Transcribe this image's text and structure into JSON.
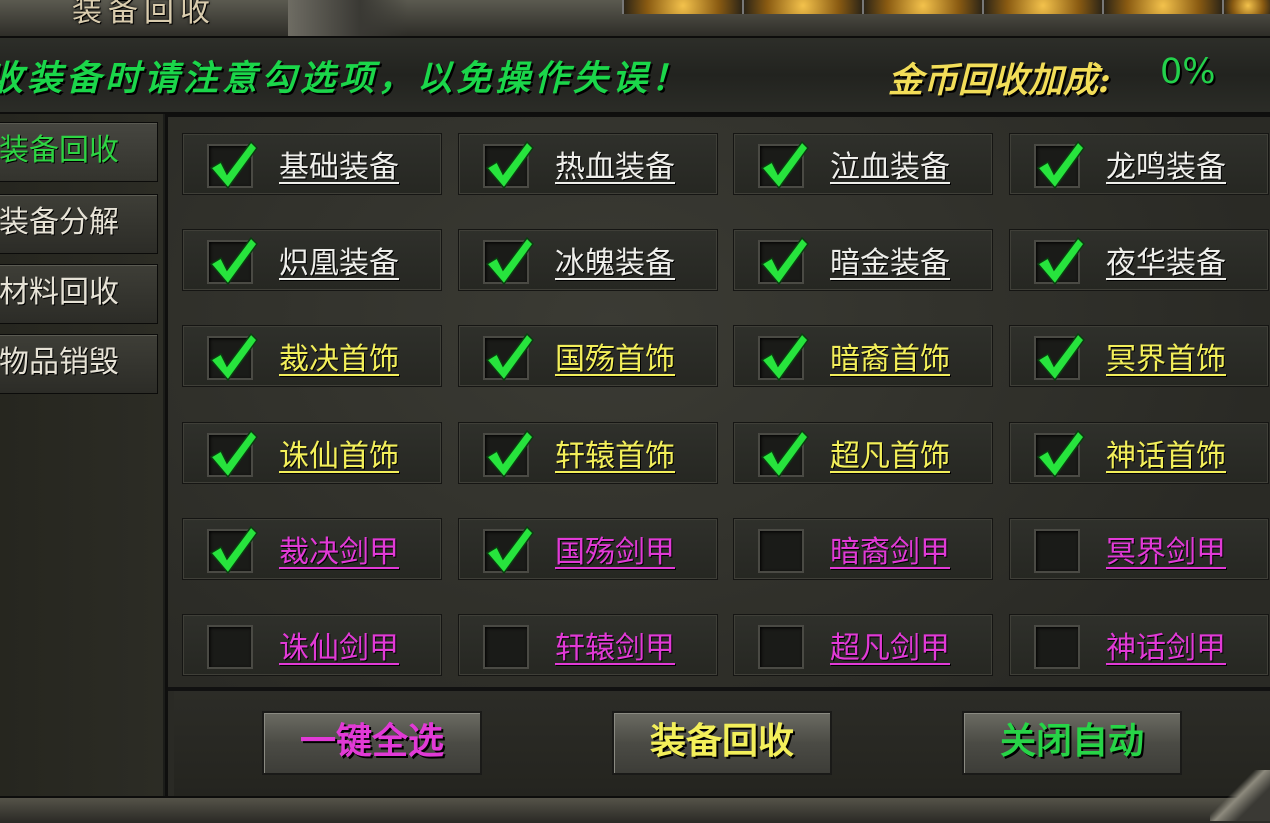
{
  "window": {
    "title": "装备回收"
  },
  "notice": {
    "text": "收装备时请注意勾选项，以免操作失误！",
    "bonus_label": "金币回收加成:",
    "bonus_value": "0%"
  },
  "sidebar": {
    "tabs": [
      {
        "label": "装备回收",
        "active": true
      },
      {
        "label": "装备分解",
        "active": false
      },
      {
        "label": "材料回收",
        "active": false
      },
      {
        "label": "物品销毁",
        "active": false
      }
    ]
  },
  "colors": {
    "white": "#eeeeea",
    "yellow": "#f3ef5a",
    "magenta": "#e13ad6",
    "green": "#27d447",
    "check": "#27e43d"
  },
  "items": [
    {
      "label": "基础装备",
      "checked": true,
      "color": "white"
    },
    {
      "label": "热血装备",
      "checked": true,
      "color": "white"
    },
    {
      "label": "泣血装备",
      "checked": true,
      "color": "white"
    },
    {
      "label": "龙鸣装备",
      "checked": true,
      "color": "white"
    },
    {
      "label": "炽凰装备",
      "checked": true,
      "color": "white"
    },
    {
      "label": "冰魄装备",
      "checked": true,
      "color": "white"
    },
    {
      "label": "暗金装备",
      "checked": true,
      "color": "white"
    },
    {
      "label": "夜华装备",
      "checked": true,
      "color": "white"
    },
    {
      "label": "裁决首饰",
      "checked": true,
      "color": "yellow"
    },
    {
      "label": "国殇首饰",
      "checked": true,
      "color": "yellow"
    },
    {
      "label": "暗裔首饰",
      "checked": true,
      "color": "yellow"
    },
    {
      "label": "冥界首饰",
      "checked": true,
      "color": "yellow"
    },
    {
      "label": "诛仙首饰",
      "checked": true,
      "color": "yellow"
    },
    {
      "label": "轩辕首饰",
      "checked": true,
      "color": "yellow"
    },
    {
      "label": "超凡首饰",
      "checked": true,
      "color": "yellow"
    },
    {
      "label": "神话首饰",
      "checked": true,
      "color": "yellow"
    },
    {
      "label": "裁决剑甲",
      "checked": true,
      "color": "magenta"
    },
    {
      "label": "国殇剑甲",
      "checked": true,
      "color": "magenta"
    },
    {
      "label": "暗裔剑甲",
      "checked": false,
      "color": "magenta"
    },
    {
      "label": "冥界剑甲",
      "checked": false,
      "color": "magenta"
    },
    {
      "label": "诛仙剑甲",
      "checked": false,
      "color": "magenta"
    },
    {
      "label": "轩辕剑甲",
      "checked": false,
      "color": "magenta"
    },
    {
      "label": "超凡剑甲",
      "checked": false,
      "color": "magenta"
    },
    {
      "label": "神话剑甲",
      "checked": false,
      "color": "magenta"
    }
  ],
  "buttons": {
    "select_all": {
      "label": "一键全选",
      "color": "magenta"
    },
    "recycle": {
      "label": "装备回收",
      "color": "yellow"
    },
    "auto_off": {
      "label": "关闭自动",
      "color": "green"
    }
  },
  "icons": {
    "checkmark": "checkmark-icon",
    "sidebar_blank": "none"
  }
}
